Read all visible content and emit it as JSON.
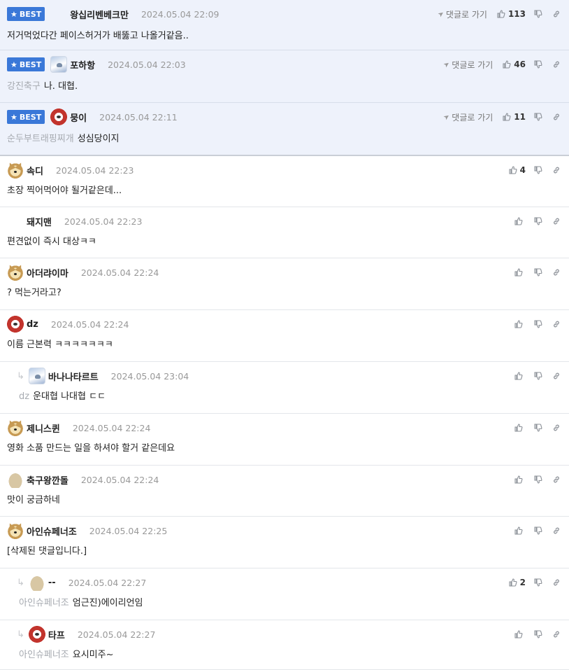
{
  "best_label": "BEST",
  "goto_label": "댓글로 가기",
  "comments": [
    {
      "best": true,
      "nick": "왕십리벤베크만",
      "time": "2024.05.04 22:09",
      "likes": "113",
      "tag": "",
      "text": "저거먹었다간 페이스허거가 배뚫고 나올거같음..",
      "avatar": "blob"
    },
    {
      "best": true,
      "nick": "포하항",
      "time": "2024.05.04 22:03",
      "likes": "46",
      "tag": "강진축구",
      "text": "나. 대협.",
      "avatar": "bird"
    },
    {
      "best": true,
      "nick": "뭉이",
      "time": "2024.05.04 22:11",
      "likes": "11",
      "tag": "순두부트래핑찌개",
      "text": "성심당이지",
      "avatar": "red"
    },
    {
      "best": false,
      "nick": "속디",
      "time": "2024.05.04 22:23",
      "likes": "4",
      "tag": "",
      "text": "초장 찍어먹어야 될거같은데...",
      "avatar": "dog"
    },
    {
      "best": false,
      "nick": "돼지맨",
      "time": "2024.05.04 22:23",
      "likes": "",
      "tag": "",
      "text": "편견없이 즉시 대상ㅋㅋ",
      "avatar": "blob"
    },
    {
      "best": false,
      "nick": "아더랴이마",
      "time": "2024.05.04 22:24",
      "likes": "",
      "tag": "",
      "text": "? 먹는거라고?",
      "avatar": "dog"
    },
    {
      "best": false,
      "nick": "dz",
      "time": "2024.05.04 22:24",
      "likes": "",
      "tag": "",
      "text": "이름 근본력 ㅋㅋㅋㅋㅋㅋㅋ",
      "avatar": "red"
    },
    {
      "best": false,
      "reply": true,
      "nick": "바나나타르트",
      "time": "2024.05.04 23:04",
      "likes": "",
      "tag": "dz",
      "text": "운대협 나대협 ㄷㄷ",
      "avatar": "bird"
    },
    {
      "best": false,
      "nick": "제니스퀸",
      "time": "2024.05.04 22:24",
      "likes": "",
      "tag": "",
      "text": "영화 소품 만드는 일을 하셔야 할거 같은데요",
      "avatar": "dog"
    },
    {
      "best": false,
      "nick": "축구왕깐돌",
      "time": "2024.05.04 22:24",
      "likes": "",
      "tag": "",
      "text": "맛이 궁금하네",
      "avatar": "mush"
    },
    {
      "best": false,
      "nick": "아인슈페너조",
      "time": "2024.05.04 22:25",
      "likes": "",
      "tag": "",
      "text": "[삭제된 댓글입니다.]",
      "avatar": "dog"
    },
    {
      "best": false,
      "reply": true,
      "nick": "--",
      "time": "2024.05.04 22:27",
      "likes": "2",
      "tag": "아인슈페너조",
      "text": "엄근진)에이리언임",
      "avatar": "mush"
    },
    {
      "best": false,
      "reply": true,
      "nick": "타프",
      "time": "2024.05.04 22:27",
      "likes": "",
      "tag": "아인슈페너조",
      "text": "요시미주~",
      "avatar": "red"
    }
  ]
}
